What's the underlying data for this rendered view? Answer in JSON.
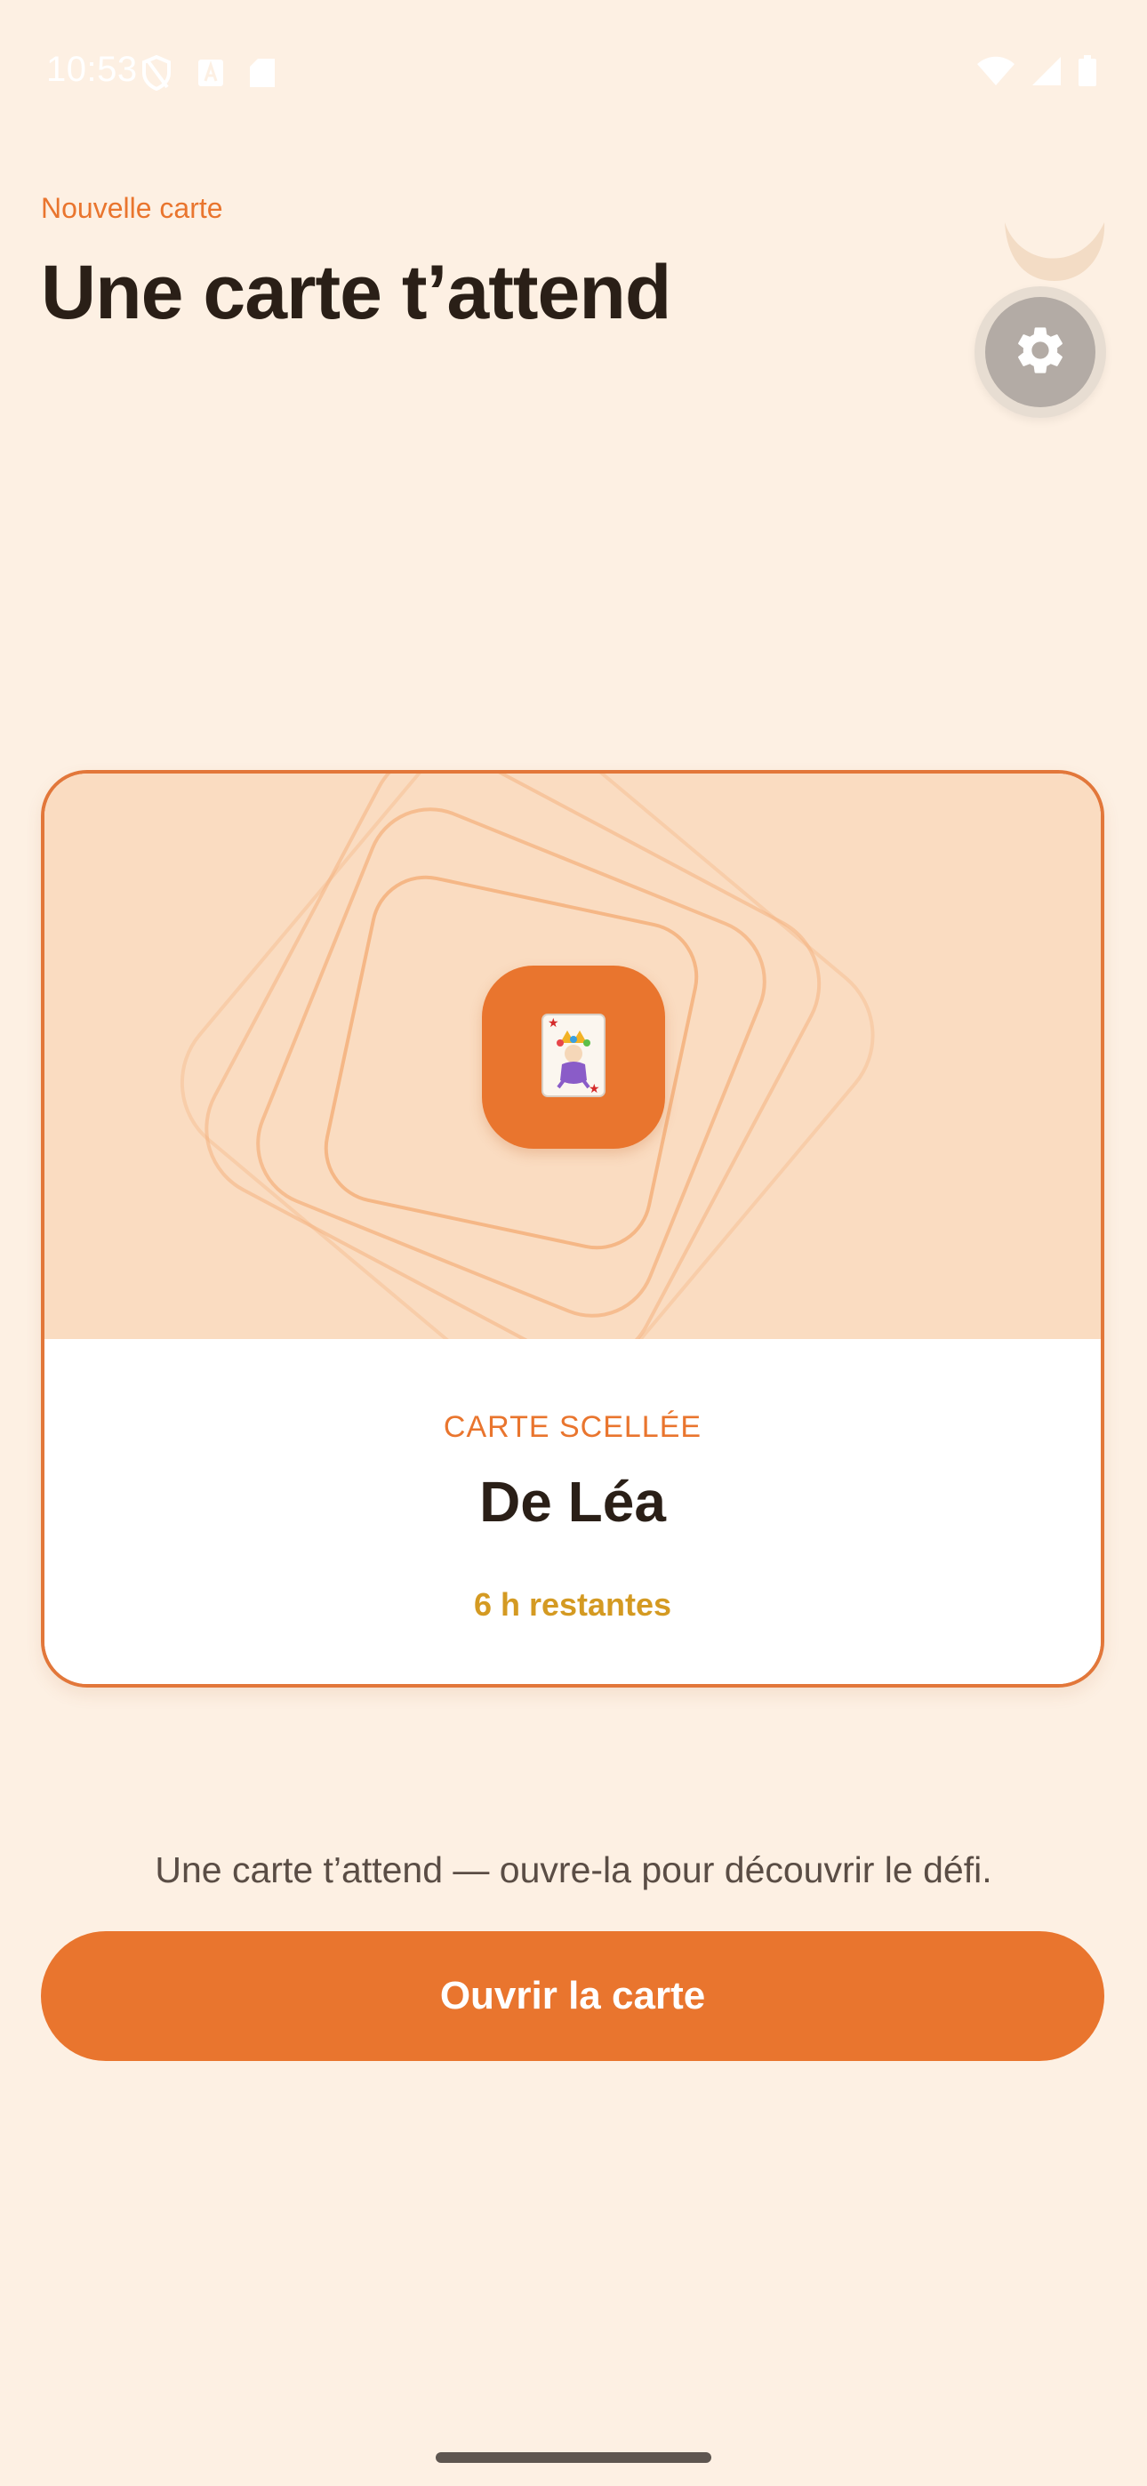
{
  "status_bar": {
    "time": "10:53",
    "left_icons": [
      "vpn-shield-icon",
      "font-a-icon",
      "sd-card-icon"
    ],
    "right_icons": [
      "wifi-icon",
      "cellular-signal-icon",
      "battery-icon"
    ]
  },
  "header": {
    "eyebrow": "Nouvelle carte",
    "title": "Une carte t’attend"
  },
  "top_right": {
    "decoration_icon": "moon-icon",
    "settings_icon": "gear-icon"
  },
  "card": {
    "art_icon": "joker-card-icon",
    "kicker": "CARTE SCELLÉE",
    "sender": "De Léa",
    "remaining": "6 h restantes"
  },
  "helper_text": "Une carte t’attend — ouvre-la pour découvrir le défi.",
  "cta": {
    "label": "Ouvrir la carte"
  },
  "colors": {
    "background": "#fdf0e3",
    "accent": "#e9752e",
    "card_art_bg": "#fadcc1",
    "remaining_text": "#d49a22",
    "title_text": "#2a1f17"
  }
}
